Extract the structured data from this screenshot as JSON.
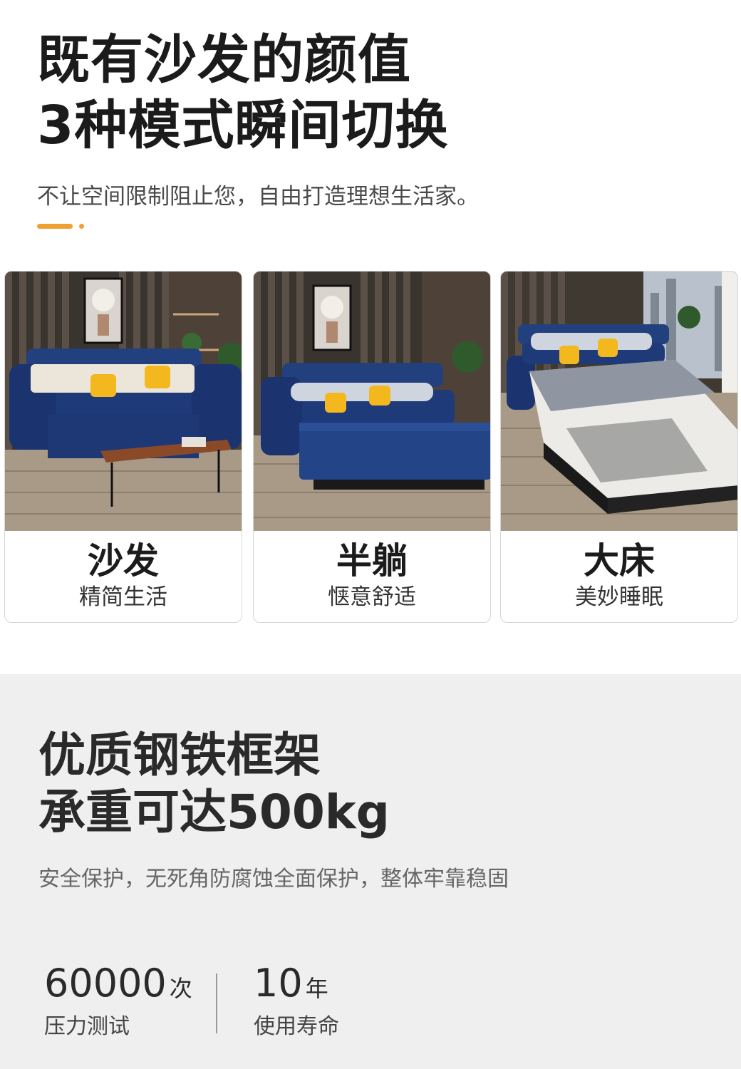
{
  "hero": {
    "title_line1": "既有沙发的颜值",
    "title_line2": "3种模式瞬间切换",
    "subtitle": "不让空间限制阻止您，自由打造理想生活家。",
    "accent_color": "#f0a030"
  },
  "modes": [
    {
      "title": "沙发",
      "subtitle": "精简生活",
      "photo": "sofa-mode-photo"
    },
    {
      "title": "半躺",
      "subtitle": "惬意舒适",
      "photo": "half-recline-mode-photo"
    },
    {
      "title": "大床",
      "subtitle": "美妙睡眠",
      "photo": "bed-mode-photo"
    }
  ],
  "frame": {
    "title_line1": "优质钢铁框架",
    "title_line2": "承重可达500kg",
    "subtitle": "安全保护，无死角防腐蚀全面保护，整体牢靠稳固"
  },
  "stats": [
    {
      "value": "60000",
      "unit": "次",
      "label": "压力测试"
    },
    {
      "value": "10",
      "unit": "年",
      "label": "使用寿命"
    }
  ],
  "colors": {
    "sofa_blue": "#1f3a78",
    "pillow_yellow": "#f2b81e",
    "bottom_bg": "#efefef"
  }
}
